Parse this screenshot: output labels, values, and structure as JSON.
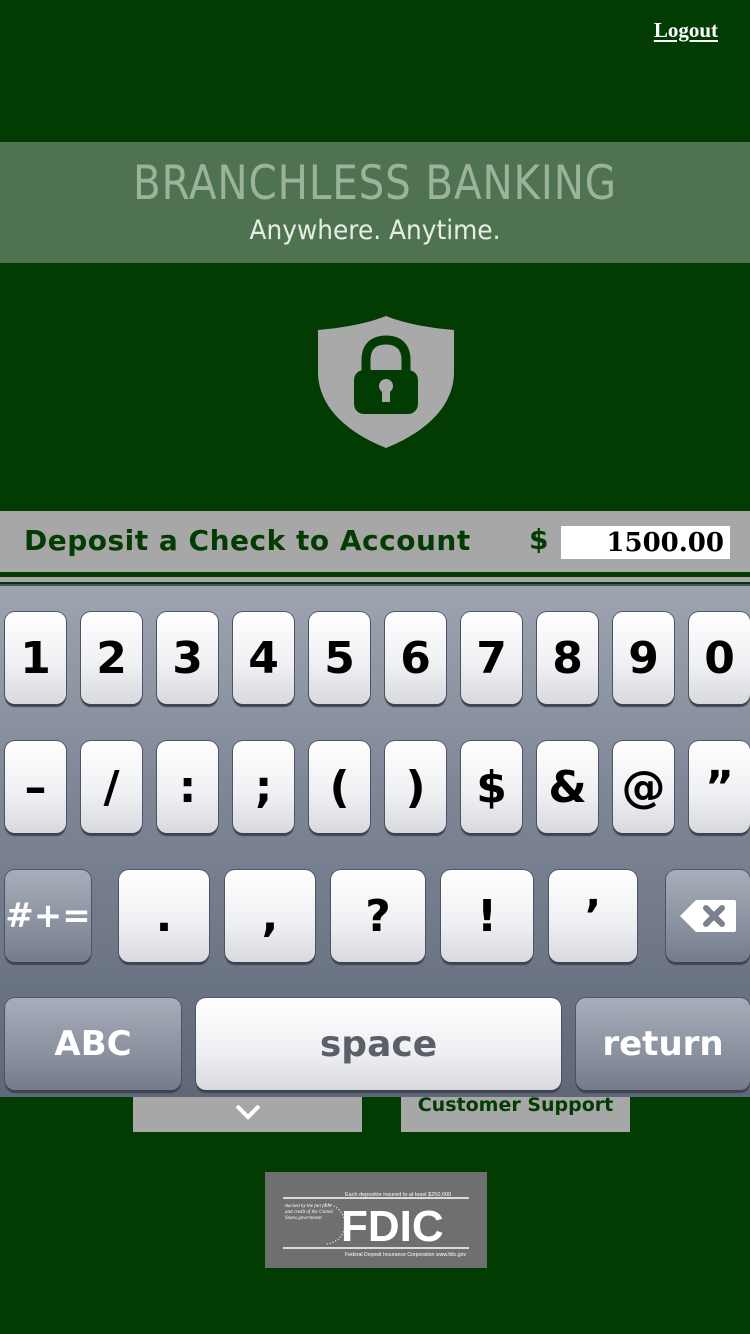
{
  "header": {
    "logout_label": "Logout"
  },
  "banner": {
    "title": "BRANCHLESS BANKING",
    "subtitle": "Anywhere.  Anytime."
  },
  "deposit": {
    "label": "Deposit a Check to Account",
    "currency_symbol": "$",
    "amount": "1500.00"
  },
  "keyboard": {
    "row1": [
      "1",
      "2",
      "3",
      "4",
      "5",
      "6",
      "7",
      "8",
      "9",
      "0"
    ],
    "row2": [
      "–",
      "/",
      ":",
      ";",
      "(",
      ")",
      "$",
      "&",
      "@",
      "”"
    ],
    "row3": {
      "mode_label": "#+=",
      "keys": [
        ".",
        ",",
        "?",
        "!",
        "’"
      ]
    },
    "row4": {
      "abc_label": "ABC",
      "space_label": "space",
      "return_label": "return"
    }
  },
  "footer": {
    "support_label": "Customer Support",
    "fdic": {
      "brand": "FDIC",
      "top_line": "Each depositor insured to at least $250,000",
      "bottom_line": "Federal Deposit Insurance Corporation www.fdic.gov",
      "side_text": "Backed by the full faith and credit of the United States government"
    }
  },
  "colors": {
    "background": "#023c02",
    "banner": "#4f7350",
    "bar": "#a7a7a7",
    "accent_text": "#023c02"
  }
}
